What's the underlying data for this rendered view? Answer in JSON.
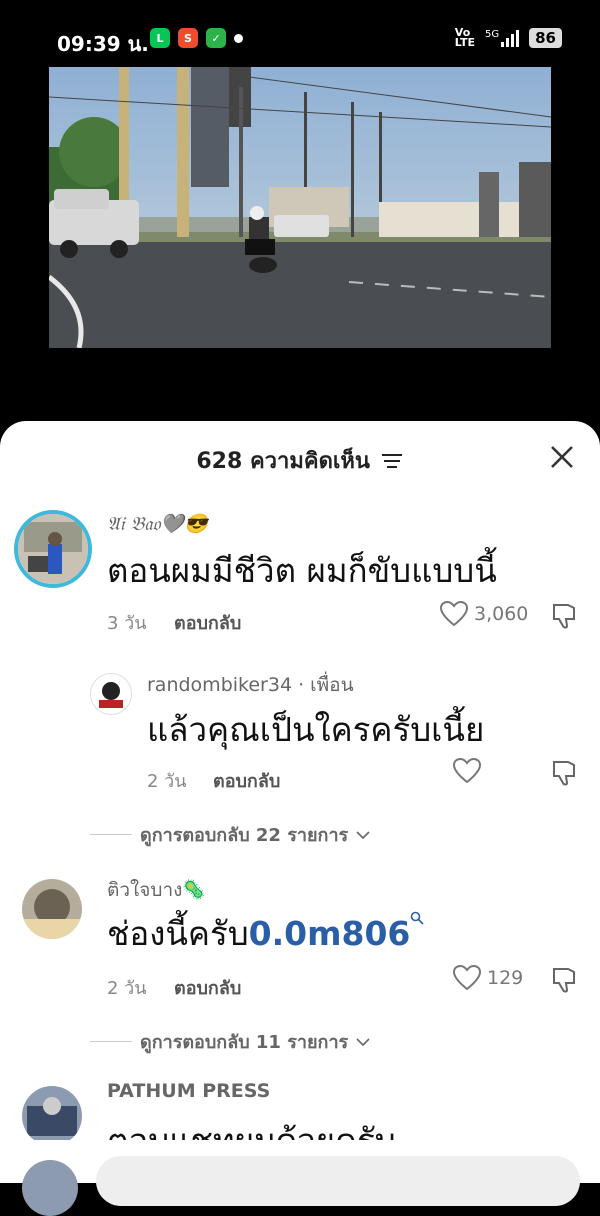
{
  "status": {
    "time": "09:39 น.",
    "volte_top": "Vo",
    "volte_bottom": "LTE",
    "net": "5G",
    "battery": "86"
  },
  "sheet": {
    "title": "628 ความคิดเห็น"
  },
  "comments": [
    {
      "name": "𝔄𝔦 𝔅𝔞𝔬🩶😎",
      "text": "ตอนผมมีชีวิต ผมก็ขับแบบนี้",
      "time": "3 วัน",
      "reply": "ตอบกลับ",
      "likes": "3,060"
    },
    {
      "name": "randombiker34 · เพื่อน",
      "text": "แล้วคุณเป็นใครครับเนี้ย",
      "time": "2 วัน",
      "reply": "ตอบกลับ",
      "likes": ""
    },
    {
      "name": "ติวใจบาง🦠",
      "text_prefix": "ช่องนี้ครับ",
      "text_link": "0.0m806",
      "time": "2 วัน",
      "reply": "ตอบกลับ",
      "likes": "129"
    },
    {
      "name": "PATHUM PRESS",
      "text": "ตอบแชทผมด้วยครับ"
    }
  ],
  "view_replies": [
    "ดูการตอบกลับ 22 รายการ",
    "ดูการตอบกลับ 11 รายการ"
  ],
  "colors": {
    "link": "#2a5ea7",
    "sheet_bg": "#ffffff",
    "ring": "#3fb9d9"
  }
}
